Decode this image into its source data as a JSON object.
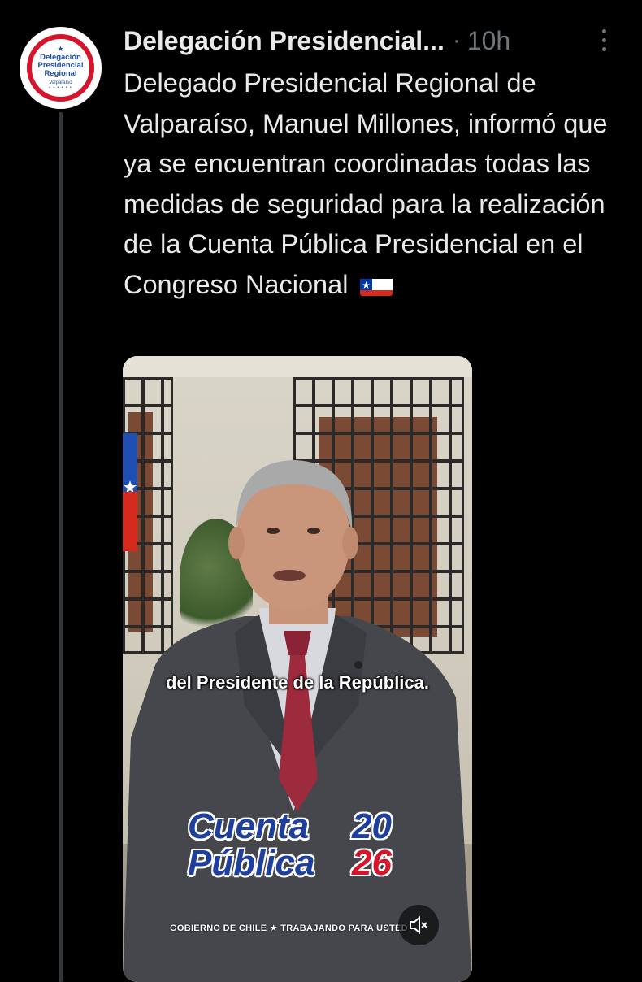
{
  "post": {
    "author": "Delegación Presidencial...",
    "separator": "·",
    "time": "10h",
    "text": "Delegado Presidencial Regional de Valparaíso, Manuel Millones, informó que ya se encuentran coordinadas todas las medidas de seguridad para la realización de la Cuenta Pública Presidencial en el Congreso Nacional",
    "emoji": "chile-flag-emoji"
  },
  "avatar": {
    "line1": "Delegación",
    "line2": "Presidencial",
    "line3": "Regional",
    "line4": "Valparaíso"
  },
  "media": {
    "subtitle": "del Presidente de la República.",
    "logo_word1": "Cuenta",
    "logo_word2": "Pública",
    "logo_year1": "20",
    "logo_year2": "26",
    "footer": "GOBIERNO DE CHILE  ★  TRABAJANDO PARA USTED",
    "mute_icon": "speaker-muted-icon"
  },
  "colors": {
    "background": "#000000",
    "text": "#e7e9ea",
    "secondary": "#71767b",
    "logo_blue": "#1f3f9c",
    "logo_red": "#d5152b"
  }
}
